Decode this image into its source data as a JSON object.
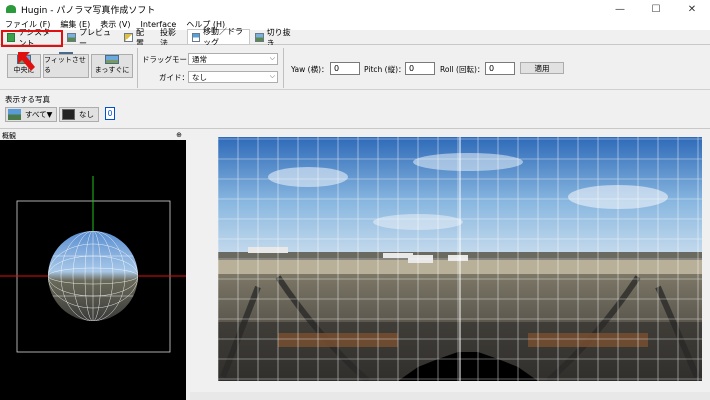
{
  "window": {
    "title": "Hugin - パノラマ写真作成ソフト",
    "minimize": "—",
    "maximize": "☐",
    "close": "✕"
  },
  "menu": [
    "ファイル (F)",
    "編集 (E)",
    "表示 (V)",
    "Interface",
    "ヘルプ (H)"
  ],
  "tabs": [
    {
      "label": "アシスタント",
      "icon": "green-flag-icon"
    },
    {
      "label": "プレビュー",
      "icon": "preview-icon"
    },
    {
      "label": "配置",
      "icon": "layout-icon"
    },
    {
      "label": "投影法",
      "icon": ""
    },
    {
      "label": "移動／ドラッグ",
      "icon": "move-drag-icon",
      "active": true
    },
    {
      "label": "切り抜き",
      "icon": "crop-icon"
    }
  ],
  "toolbar": {
    "center_label": "中央に",
    "fit_label": "フィットさせる",
    "straighten_label": "まっすぐに",
    "drag_mode_label": "ドラッグモード：",
    "drag_mode_value": "通常",
    "guide_label": "ガイド：",
    "guide_value": "なし",
    "yaw_label": "Yaw (横)：",
    "yaw_value": "0",
    "pitch_label": "Pitch (縦)：",
    "pitch_value": "0",
    "roll_label": "Roll (回転)：",
    "roll_value": "0",
    "apply_label": "適用"
  },
  "show_images": {
    "label": "表示する写真",
    "all_label": "すべて▼",
    "none_label": "なし",
    "count": "0"
  },
  "overview": {
    "label": "概観",
    "pin": "⊕"
  },
  "colors": {
    "highlight": "#e01010",
    "grid": "#ffffff",
    "axis_red": "#e01010",
    "axis_green": "#20c020"
  }
}
